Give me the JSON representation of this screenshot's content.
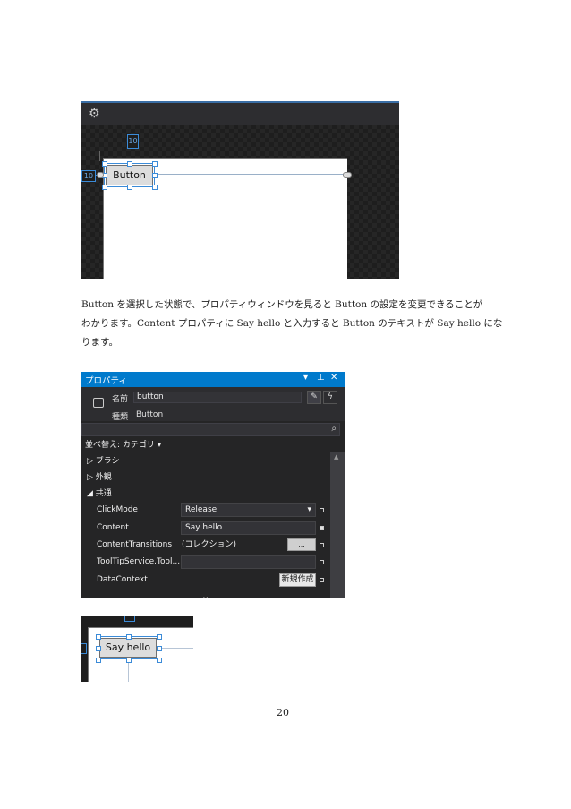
{
  "figure1": {
    "button_label": "Button",
    "margin_left": "10",
    "margin_top": "10"
  },
  "paragraph": {
    "line1": "Button を選択した状態で、プロパティウィンドウを見ると Button の設定を変更できることが",
    "line2": "わかります。Content プロパティに Say hello と入力すると Button のテキストが Say hello にな",
    "line3": "ります。"
  },
  "properties_panel": {
    "title": "プロパティ",
    "title_icons": [
      "▾",
      "ᛒ",
      "✕"
    ],
    "name_label": "名前",
    "name_value": "button",
    "type_label": "種類",
    "type_value": "Button",
    "sort_label": "並べ替え: カテゴリ ▾",
    "categories": [
      {
        "arrow": "▷",
        "label": "ブラシ"
      },
      {
        "arrow": "▷",
        "label": "外観"
      },
      {
        "arrow": "◢",
        "label": "共通"
      }
    ],
    "properties": [
      {
        "name": "ClickMode",
        "value": "Release",
        "dropdown": "▾"
      },
      {
        "name": "Content",
        "value": "Say hello"
      },
      {
        "name": "ContentTransitions",
        "value": "(コレクション)",
        "button": "..."
      },
      {
        "name": "ToolTipService.Tool...",
        "value": ""
      },
      {
        "name": "DataContext",
        "value": "",
        "button": "新規作成"
      }
    ],
    "more_indicator": "⌄"
  },
  "figure3": {
    "button_label": "Say hello"
  },
  "page_number": "20"
}
